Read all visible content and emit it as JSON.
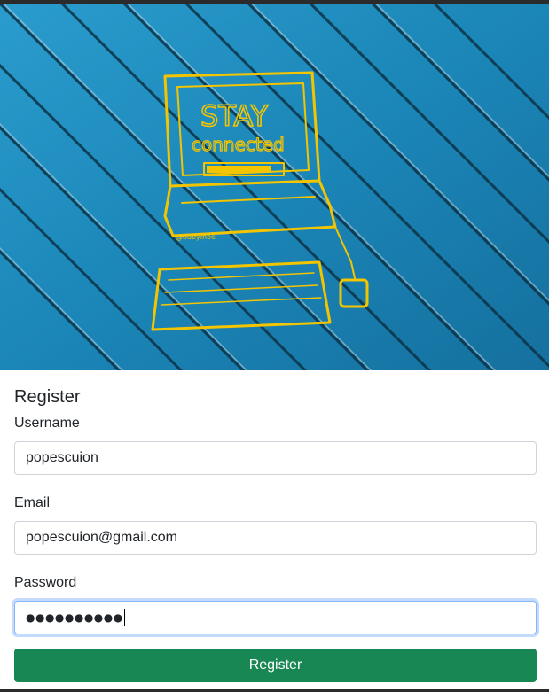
{
  "hero": {
    "graffiti_line1": "STAY",
    "graffiti_line2": "connected",
    "graffiti_tag": "@babyinoe"
  },
  "form": {
    "title": "Register",
    "username": {
      "label": "Username",
      "value": "popescuion"
    },
    "email": {
      "label": "Email",
      "value": "popescuion@gmail.com"
    },
    "password": {
      "label": "Password",
      "masked_value": "●●●●●●●●●●"
    },
    "submit_label": "Register"
  },
  "colors": {
    "fence_blue": "#1d87b9",
    "graffiti_yellow": "#f3c400",
    "button_green": "#198754",
    "focus_border": "#86b7fe"
  }
}
